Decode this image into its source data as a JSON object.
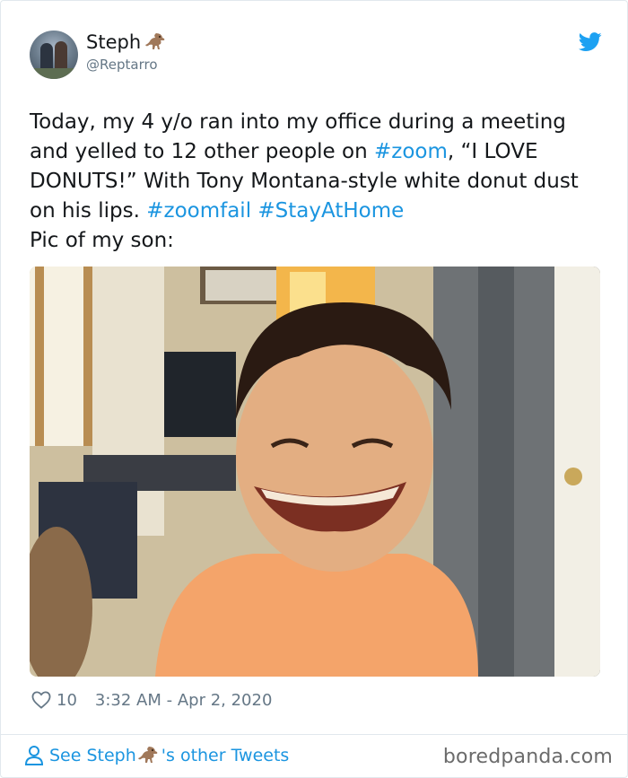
{
  "author": {
    "name": "Steph",
    "name_emoji": "t-rex-emoji",
    "handle": "@Reptarro",
    "avatar": "profile-photo"
  },
  "tweet": {
    "segments": [
      {
        "text": "Today, my 4 y/o ran into my office during a meeting and yelled to 12 other people on ",
        "type": "text"
      },
      {
        "text": "#zoom",
        "type": "hashtag"
      },
      {
        "text": ", “I LOVE DONUTS!” With Tony Montana-style white donut dust on his lips. ",
        "type": "text"
      },
      {
        "text": "#zoomfail",
        "type": "hashtag"
      },
      {
        "text": " ",
        "type": "text"
      },
      {
        "text": "#StayAtHome",
        "type": "hashtag"
      },
      {
        "text": "\nPic of my son:",
        "type": "text"
      }
    ],
    "image": "child-smiling-photo"
  },
  "meta": {
    "like_icon": "heart-icon",
    "likes": "10",
    "timestamp": "3:32 AM - Apr 2, 2020"
  },
  "footer": {
    "see_more_prefix": "See Steph",
    "see_more_suffix": "'s other Tweets",
    "watermark": "boredpanda.com"
  },
  "colors": {
    "link": "#1b95e0",
    "text": "#14171a",
    "muted": "#657786",
    "border": "#e1e8ed"
  }
}
